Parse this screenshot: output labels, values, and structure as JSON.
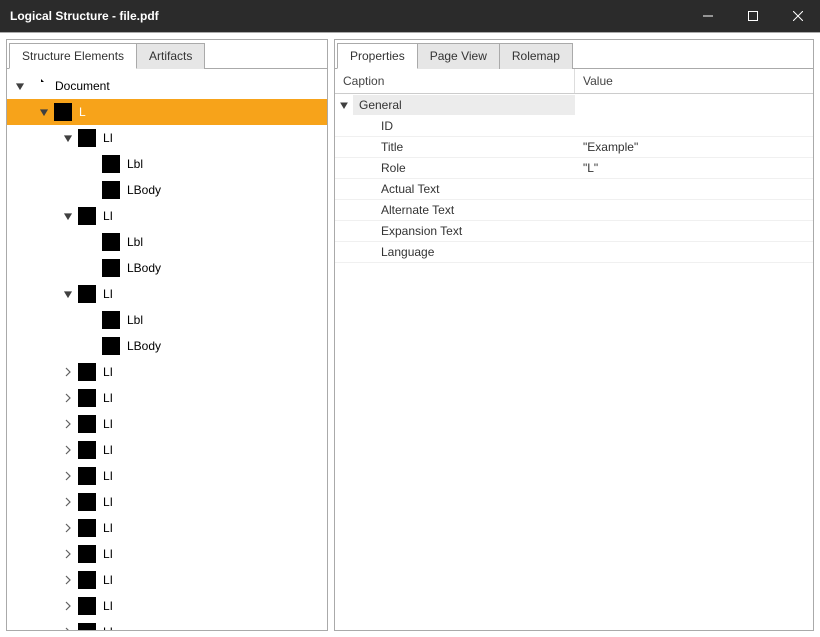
{
  "window": {
    "title": "Logical Structure - file.pdf"
  },
  "leftTabs": [
    {
      "label": "Structure Elements",
      "active": true
    },
    {
      "label": "Artifacts",
      "active": false
    }
  ],
  "rightTabs": [
    {
      "label": "Properties",
      "active": true
    },
    {
      "label": "Page View",
      "active": false
    },
    {
      "label": "Rolemap",
      "active": false
    }
  ],
  "tree": [
    {
      "depth": 0,
      "expand": "open",
      "icon": "doc",
      "label": "Document",
      "selected": false
    },
    {
      "depth": 1,
      "expand": "open",
      "icon": "tag",
      "label": "L",
      "selected": true
    },
    {
      "depth": 2,
      "expand": "open",
      "icon": "tag",
      "label": "LI",
      "selected": false
    },
    {
      "depth": 3,
      "expand": "none",
      "icon": "tag",
      "label": "Lbl",
      "selected": false
    },
    {
      "depth": 3,
      "expand": "none",
      "icon": "tag",
      "label": "LBody",
      "selected": false
    },
    {
      "depth": 2,
      "expand": "open",
      "icon": "tag",
      "label": "LI",
      "selected": false
    },
    {
      "depth": 3,
      "expand": "none",
      "icon": "tag",
      "label": "Lbl",
      "selected": false
    },
    {
      "depth": 3,
      "expand": "none",
      "icon": "tag",
      "label": "LBody",
      "selected": false
    },
    {
      "depth": 2,
      "expand": "open",
      "icon": "tag",
      "label": "LI",
      "selected": false
    },
    {
      "depth": 3,
      "expand": "none",
      "icon": "tag",
      "label": "Lbl",
      "selected": false
    },
    {
      "depth": 3,
      "expand": "none",
      "icon": "tag",
      "label": "LBody",
      "selected": false
    },
    {
      "depth": 2,
      "expand": "closed",
      "icon": "tag",
      "label": "LI",
      "selected": false
    },
    {
      "depth": 2,
      "expand": "closed",
      "icon": "tag",
      "label": "LI",
      "selected": false
    },
    {
      "depth": 2,
      "expand": "closed",
      "icon": "tag",
      "label": "LI",
      "selected": false
    },
    {
      "depth": 2,
      "expand": "closed",
      "icon": "tag",
      "label": "LI",
      "selected": false
    },
    {
      "depth": 2,
      "expand": "closed",
      "icon": "tag",
      "label": "LI",
      "selected": false
    },
    {
      "depth": 2,
      "expand": "closed",
      "icon": "tag",
      "label": "LI",
      "selected": false
    },
    {
      "depth": 2,
      "expand": "closed",
      "icon": "tag",
      "label": "LI",
      "selected": false
    },
    {
      "depth": 2,
      "expand": "closed",
      "icon": "tag",
      "label": "LI",
      "selected": false
    },
    {
      "depth": 2,
      "expand": "closed",
      "icon": "tag",
      "label": "LI",
      "selected": false
    },
    {
      "depth": 2,
      "expand": "closed",
      "icon": "tag",
      "label": "LI",
      "selected": false
    },
    {
      "depth": 2,
      "expand": "closed",
      "icon": "tag",
      "label": "LI",
      "selected": false
    }
  ],
  "propHeader": {
    "caption": "Caption",
    "value": "Value"
  },
  "propGroup": {
    "label": "General"
  },
  "properties": [
    {
      "caption": "ID",
      "value": ""
    },
    {
      "caption": "Title",
      "value": "\"Example\""
    },
    {
      "caption": "Role",
      "value": "\"L\""
    },
    {
      "caption": "Actual Text",
      "value": ""
    },
    {
      "caption": "Alternate Text",
      "value": ""
    },
    {
      "caption": "Expansion Text",
      "value": ""
    },
    {
      "caption": "Language",
      "value": ""
    }
  ]
}
